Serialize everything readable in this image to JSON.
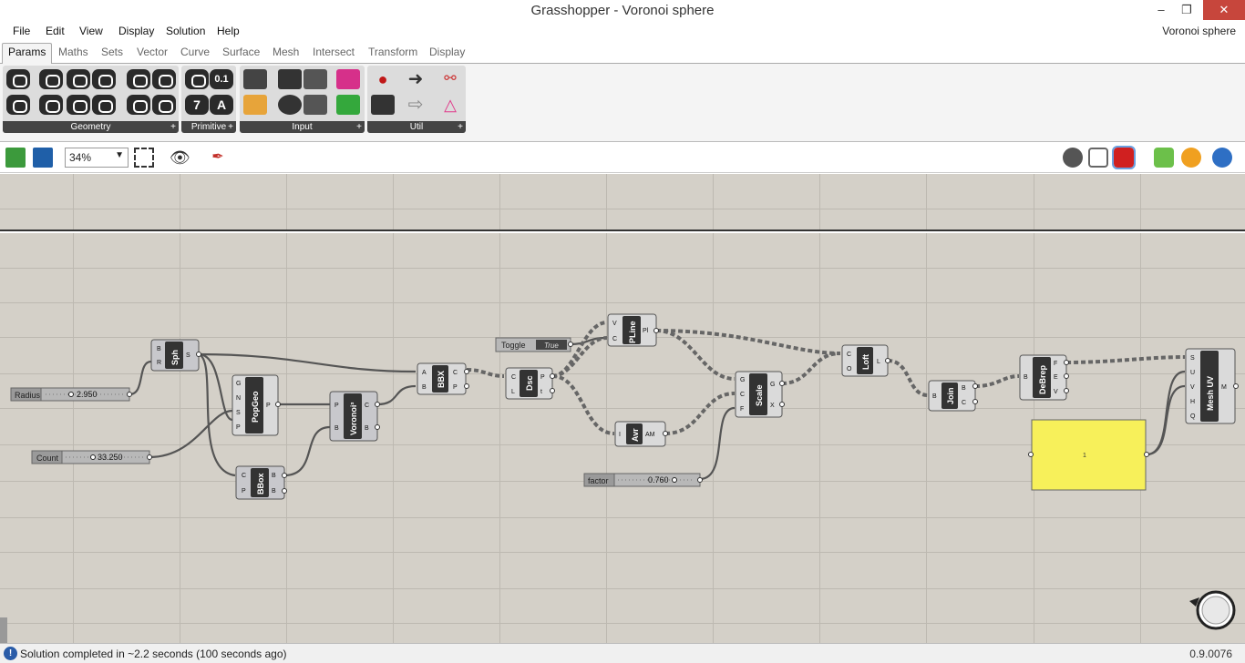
{
  "window": {
    "title": "Grasshopper - Voronoi sphere",
    "min": "–",
    "max": "❐",
    "close": "✕"
  },
  "menu": {
    "items": [
      "File",
      "Edit",
      "View",
      "Display",
      "Solution",
      "Help"
    ],
    "doc_name": "Voronoi sphere"
  },
  "tabs": [
    "Params",
    "Maths",
    "Sets",
    "Vector",
    "Curve",
    "Surface",
    "Mesh",
    "Intersect",
    "Transform",
    "Display"
  ],
  "ribbon_groups": [
    "Geometry",
    "Primitive",
    "Input",
    "Util"
  ],
  "toolbar": {
    "zoom": "34%"
  },
  "components": {
    "sph": {
      "name": "Sph",
      "inputs": [
        "B",
        "R"
      ],
      "outputs": [
        "S"
      ]
    },
    "popgeo": {
      "name": "PopGeo",
      "inputs": [
        "G",
        "N",
        "S",
        "P"
      ],
      "outputs": [
        "P"
      ]
    },
    "bbox": {
      "name": "BBox",
      "inputs": [
        "C",
        "P"
      ],
      "outputs": [
        "B",
        "B"
      ]
    },
    "voronoi": {
      "name": "Voronoi³",
      "inputs": [
        "P",
        "B"
      ],
      "outputs": [
        "C",
        "B"
      ]
    },
    "bbx": {
      "name": "BBX",
      "inputs": [
        "A",
        "B"
      ],
      "outputs": [
        "C",
        "P"
      ]
    },
    "dsc": {
      "name": "Dsc",
      "inputs": [
        "C",
        "L"
      ],
      "outputs": [
        "P",
        "t"
      ]
    },
    "pline": {
      "name": "PLine",
      "inputs": [
        "V",
        "C"
      ],
      "outputs": [
        "Pl"
      ]
    },
    "avr": {
      "name": "Avr",
      "inputs": [
        "I"
      ],
      "outputs": [
        "AM"
      ]
    },
    "scale": {
      "name": "Scale",
      "inputs": [
        "G",
        "C",
        "F"
      ],
      "outputs": [
        "G",
        "X"
      ]
    },
    "loft": {
      "name": "Loft",
      "inputs": [
        "C",
        "O"
      ],
      "outputs": [
        "L"
      ]
    },
    "join": {
      "name": "Join",
      "inputs": [
        "B"
      ],
      "outputs": [
        "B",
        "C"
      ]
    },
    "debrep": {
      "name": "DeBrep",
      "inputs": [
        "B"
      ],
      "outputs": [
        "F",
        "E",
        "V"
      ]
    },
    "meshuv": {
      "name": "Mesh UV",
      "inputs": [
        "S",
        "U",
        "V",
        "H",
        "Q"
      ],
      "outputs": [
        "M"
      ]
    }
  },
  "sliders": {
    "radius": {
      "label": "Radius",
      "value": "2.950"
    },
    "count": {
      "label": "Count",
      "value": "33.250"
    },
    "factor": {
      "label": "factor",
      "value": "0.760"
    }
  },
  "toggle": {
    "label": "Toggle",
    "value": "True"
  },
  "panel": {
    "content": "1",
    "color": "#f7f05a"
  },
  "status": {
    "message": "Solution completed in ~2.2 seconds (100 seconds ago)",
    "version": "0.9.0076"
  }
}
